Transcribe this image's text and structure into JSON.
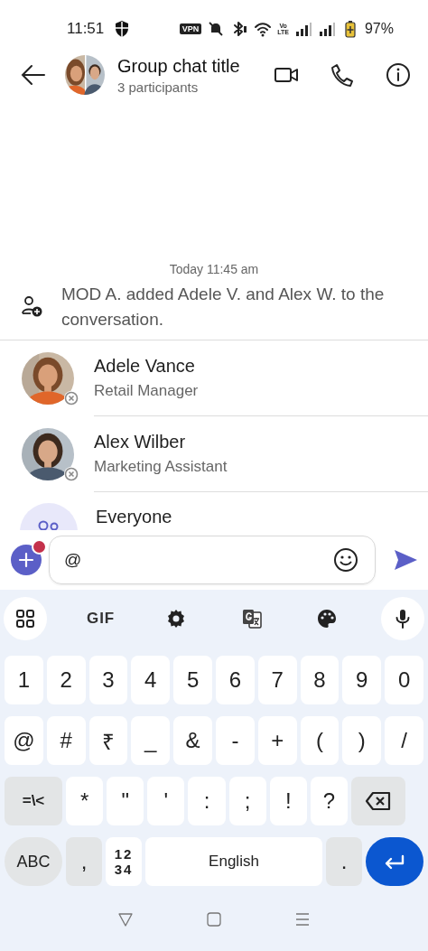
{
  "status_bar": {
    "time": "11:51",
    "vpn": "VPN",
    "volte": [
      "Vo",
      "LTE"
    ],
    "battery": "97%"
  },
  "header": {
    "title": "Group chat title",
    "subtitle": "3 participants"
  },
  "conversation": {
    "timestamp": "Today 11:45 am",
    "system_message": "MOD A. added Adele V. and Alex W. to the conversation."
  },
  "mentions": [
    {
      "kind": "person",
      "name": "Adele Vance",
      "role": "Retail Manager",
      "offline": true
    },
    {
      "kind": "person",
      "name": "Alex Wilber",
      "role": "Marketing Assistant",
      "offline": true
    },
    {
      "kind": "group",
      "name": "Everyone"
    }
  ],
  "composer": {
    "value": "@",
    "attach_badge": true
  },
  "keyboard": {
    "toolbar": [
      {
        "kind": "grid"
      },
      {
        "kind": "gif",
        "label": "GIF"
      },
      {
        "kind": "settings"
      },
      {
        "kind": "translate"
      },
      {
        "kind": "palette"
      },
      {
        "kind": "mic"
      }
    ],
    "number_row": [
      {
        "kind": "char",
        "label": "1"
      },
      {
        "kind": "char",
        "label": "2"
      },
      {
        "kind": "char",
        "label": "3"
      },
      {
        "kind": "char",
        "label": "4"
      },
      {
        "kind": "char",
        "label": "5"
      },
      {
        "kind": "char",
        "label": "6"
      },
      {
        "kind": "char",
        "label": "7"
      },
      {
        "kind": "char",
        "label": "8"
      },
      {
        "kind": "char",
        "label": "9"
      },
      {
        "kind": "char",
        "label": "0"
      }
    ],
    "symbol_row": [
      {
        "kind": "char",
        "label": "@"
      },
      {
        "kind": "char",
        "label": "#"
      },
      {
        "kind": "char",
        "label": "₹"
      },
      {
        "kind": "char",
        "label": "_"
      },
      {
        "kind": "char",
        "label": "&"
      },
      {
        "kind": "char",
        "label": "-"
      },
      {
        "kind": "char",
        "label": "+"
      },
      {
        "kind": "char",
        "label": "("
      },
      {
        "kind": "char",
        "label": ")"
      },
      {
        "kind": "char",
        "label": "/"
      }
    ],
    "punctuation_row": [
      {
        "kind": "mode",
        "label": "=\\<"
      },
      {
        "kind": "char",
        "label": "*"
      },
      {
        "kind": "char",
        "label": "\""
      },
      {
        "kind": "char",
        "label": "'"
      },
      {
        "kind": "char",
        "label": ":"
      },
      {
        "kind": "char",
        "label": ";"
      },
      {
        "kind": "char",
        "label": "!"
      },
      {
        "kind": "char",
        "label": "?"
      },
      {
        "kind": "backspace"
      }
    ],
    "bottom_row": [
      {
        "kind": "abc",
        "label": "ABC"
      },
      {
        "kind": "punct",
        "label": ","
      },
      {
        "kind": "numpad",
        "lines": [
          "12",
          "34"
        ]
      },
      {
        "kind": "space",
        "label": "English"
      },
      {
        "kind": "punct",
        "label": "."
      },
      {
        "kind": "enter"
      }
    ]
  },
  "nav_bar": [
    {
      "kind": "back"
    },
    {
      "kind": "home"
    },
    {
      "kind": "recents"
    }
  ]
}
